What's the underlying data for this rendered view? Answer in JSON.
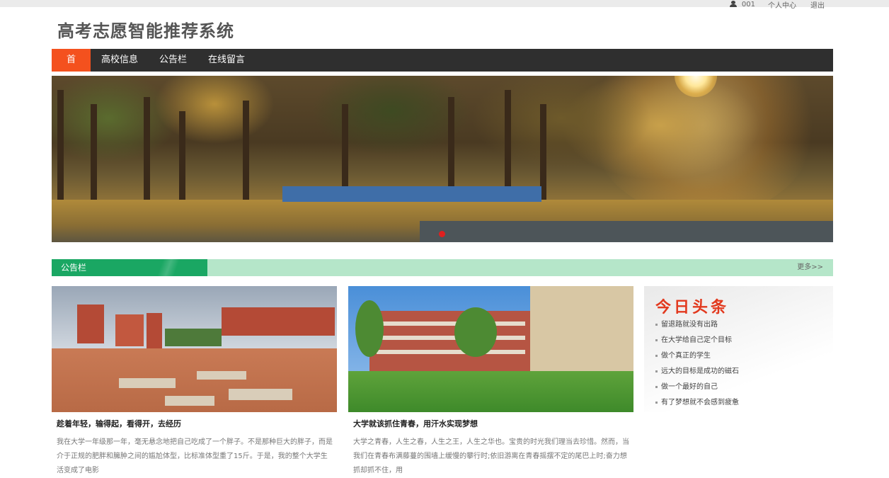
{
  "user_bar": {
    "username": "001",
    "profile_link": "个人中心",
    "logout_link": "退出",
    "icon": "user-icon"
  },
  "site": {
    "title": "高考志愿智能推荐系统"
  },
  "nav": {
    "items": [
      {
        "label": "首页",
        "active": true
      },
      {
        "label": "高校信息",
        "active": false
      },
      {
        "label": "公告栏",
        "active": false
      },
      {
        "label": "在线留言",
        "active": false
      }
    ]
  },
  "banner": {
    "active_slide_indicator": "slide-dot"
  },
  "notice_section": {
    "title": "公告栏",
    "more": "更多>>"
  },
  "cards": [
    {
      "title": "趁着年轻，输得起，看得开，去经历",
      "text": "我在大学一年级那一年，毫无悬念地把自己吃成了一个胖子。不是那种巨大的胖子，而是介于正规的肥胖和臃肿之间的尴尬体型，比标准体型重了15斤。于是，我的整个大学生活变成了电影"
    },
    {
      "title": "大学就该抓住青春，用汗水实现梦想",
      "text": "大学之青春，人生之春，人生之王，人生之华也。宝贵的时光我们理当去珍惜。然而，当我们在青春布满藤蔓的围墙上缓慢的攀行时;依旧游离在青春摇摆不定的尾巴上时;奋力想抓却抓不住，用"
    }
  ],
  "headlines": {
    "title": "今日头条",
    "items": [
      "留退路就没有出路",
      "在大学给自己定个目标",
      "做个真正的学生",
      "远大的目标是成功的磁石",
      "做一个最好的自己",
      "有了梦想就不会感到疲惫"
    ]
  },
  "colors": {
    "nav_bg": "#2f2f2f",
    "nav_active": "#f4511e",
    "notice_green": "#1aa763",
    "notice_light": "#b5e6c9",
    "headline_red": "#e2391e"
  }
}
